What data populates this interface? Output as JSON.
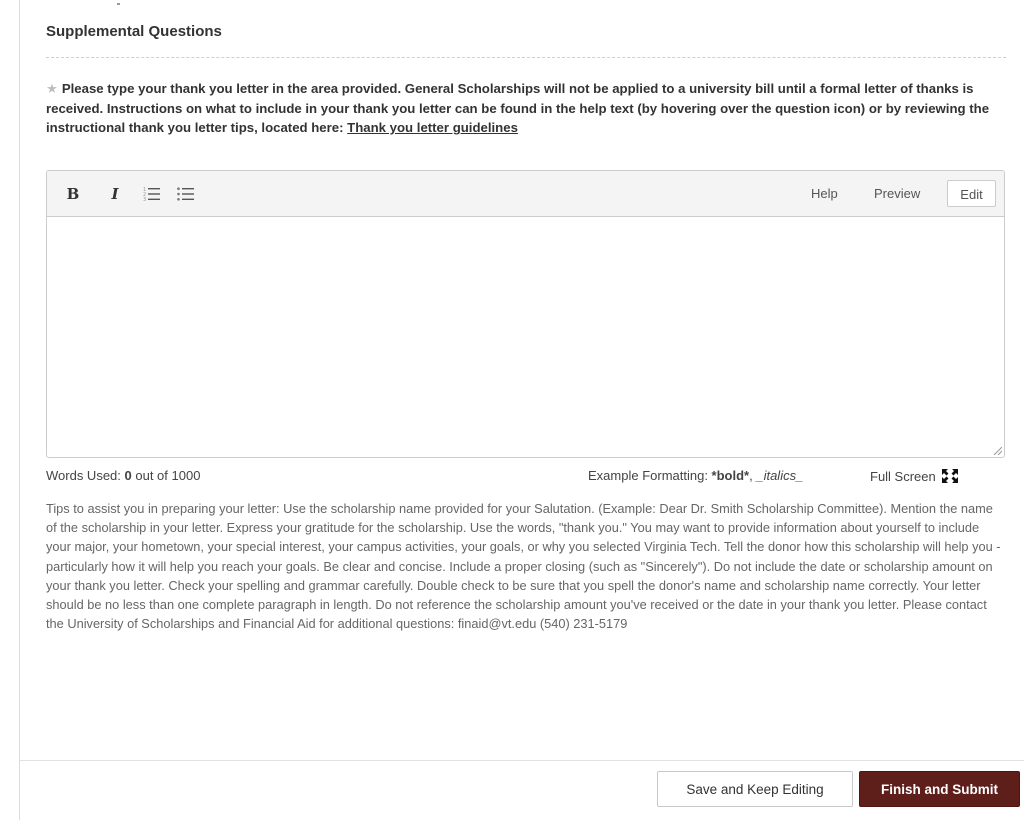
{
  "section": {
    "title": "Supplemental Questions"
  },
  "prompt": {
    "required_star": "★",
    "text": "Please type your thank you letter in the area provided. General Scholarships will not be applied to a university bill until a formal letter of thanks is received. Instructions on what to include in your thank you letter can be found in the help text (by hovering over the question icon) or by reviewing the instructional thank you letter tips, located here: ",
    "link_label": "Thank you letter guidelines"
  },
  "editor": {
    "toolbar": {
      "bold_label": "B",
      "italic_label": "I",
      "help_label": "Help",
      "preview_label": "Preview",
      "edit_label": "Edit"
    },
    "value": "",
    "icons": {
      "numbered_list": "ordered-list-icon",
      "bullet_list": "unordered-list-icon",
      "resize": "resize-grip-icon",
      "full_screen": "expand-icon"
    }
  },
  "footer_info": {
    "words_used_prefix": "Words Used: ",
    "words_used_count": "0",
    "words_used_suffix": " out of 1000",
    "example_prefix": "Example Formatting: ",
    "example_bold": "*bold*",
    "example_separator": ", ",
    "example_italics": "_italics_",
    "full_screen_label": "Full Screen"
  },
  "tips": "Tips to assist you in preparing your letter: Use the scholarship name provided for your Salutation. (Example: Dear Dr. Smith Scholarship Committee). Mention the name of the scholarship in your letter. Express your gratitude for the scholarship. Use the words, \"thank you.\" You may want to provide information about yourself to include your major, your hometown, your special interest, your campus activities, your goals, or why you selected Virginia Tech. Tell the donor how this scholarship will help you - particularly how it will help you reach your goals. Be clear and concise. Include a proper closing (such as \"Sincerely\"). Do not include the date or scholarship amount on your thank you letter. Check your spelling and grammar carefully. Double check to be sure that you spell the donor's name and scholarship name correctly. Your letter should be no less than one complete paragraph in length. Do not reference the scholarship amount you've received or the date in your thank you letter. Please contact the University of Scholarships and Financial Aid for additional questions: finaid@vt.edu (540) 231-5179",
  "actions": {
    "save_label": "Save and Keep Editing",
    "submit_label": "Finish and Submit"
  },
  "colors": {
    "submit_background": "#5e1e1a",
    "text": "#333333",
    "muted_text": "#666666",
    "border": "#cccccc"
  }
}
